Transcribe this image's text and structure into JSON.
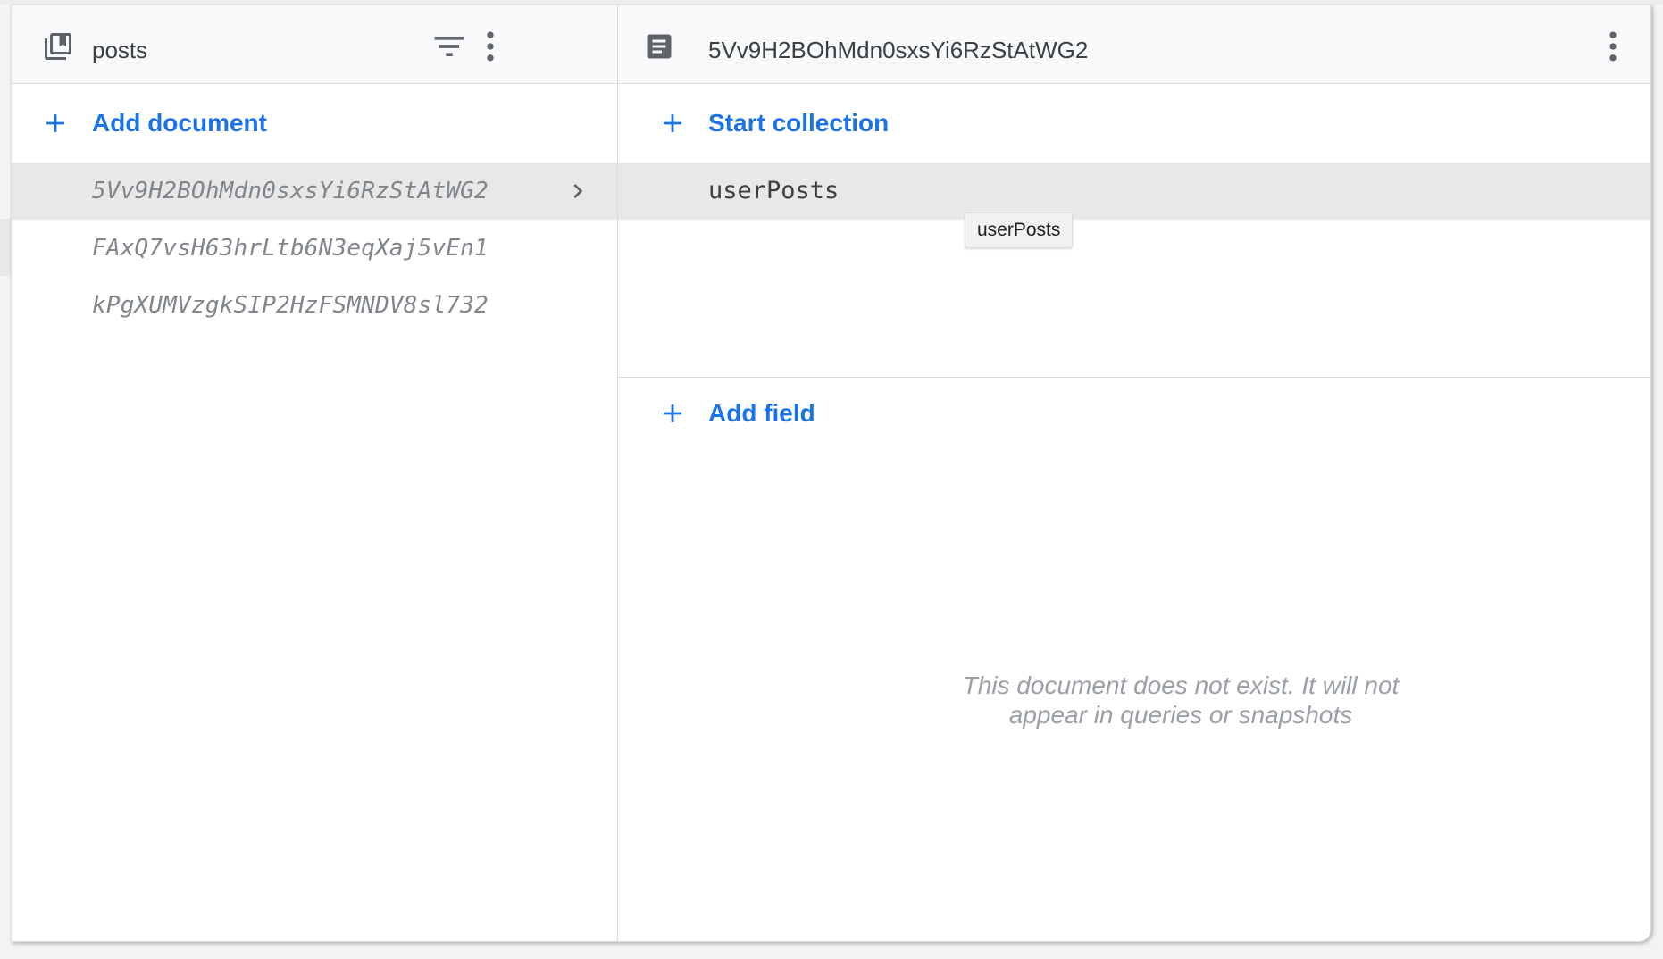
{
  "collection_panel": {
    "title": "posts",
    "add_label": "Add document",
    "documents": [
      {
        "id": "5Vv9H2BOhMdn0sxsYi6RzStAtWG2",
        "selected": true
      },
      {
        "id": "FAxQ7vsH63hrLtb6N3eqXaj5vEn1",
        "selected": false
      },
      {
        "id": "kPgXUMVzgkSIP2HzFSMNDV8sl732",
        "selected": false
      }
    ]
  },
  "document_panel": {
    "title": "5Vv9H2BOhMdn0sxsYi6RzStAtWG2",
    "start_collection_label": "Start collection",
    "subcollection": "userPosts",
    "tooltip": "userPosts",
    "add_field_label": "Add field",
    "empty_message_line1": "This document does not exist. It will not",
    "empty_message_line2": "appear in queries or snapshots"
  },
  "icons": {
    "collection": "collection-icon",
    "document": "document-icon",
    "filter": "filter-icon",
    "more": "more-vert-icon",
    "plus": "plus-icon",
    "chevron": "chevron-right-icon"
  },
  "colors": {
    "accent": "#1a73e8",
    "selected_bg": "#e8e8e8",
    "header_bg": "#f8f9fa"
  }
}
